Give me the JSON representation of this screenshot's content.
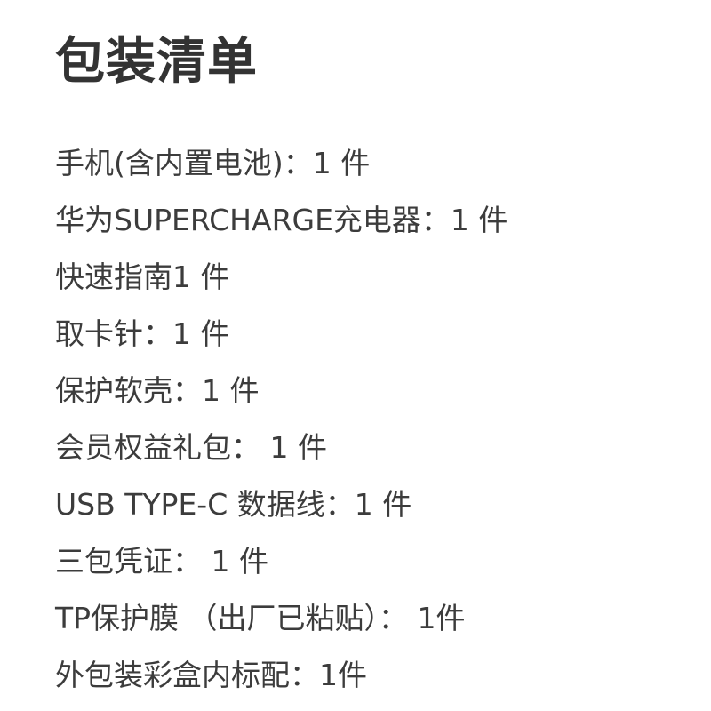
{
  "title": "包装清单",
  "items": [
    "手机(含内置电池)：1 件",
    "华为SUPERCHARGE充电器：1 件",
    "快速指南1 件",
    "取卡针：1 件",
    "保护软壳：1 件",
    "会员权益礼包： 1 件",
    "USB TYPE-C 数据线：1 件",
    "三包凭证： 1 件",
    "TP保护膜 （出厂已粘贴）： 1件",
    "外包装彩盒内标配：1件"
  ]
}
